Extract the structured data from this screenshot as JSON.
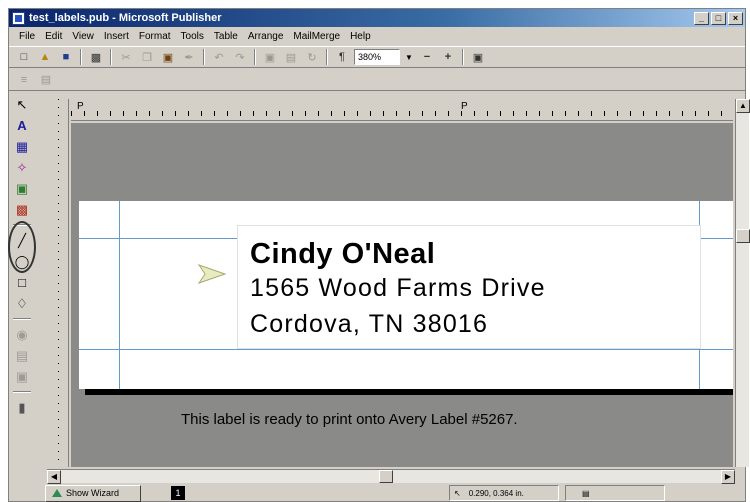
{
  "window": {
    "title": "test_labels.pub - Microsoft Publisher"
  },
  "menu": [
    "File",
    "Edit",
    "View",
    "Insert",
    "Format",
    "Tools",
    "Table",
    "Arrange",
    "MailMerge",
    "Help"
  ],
  "toolbar": {
    "zoom": "380%"
  },
  "ruler": {
    "first_indent": "P",
    "second_indent": "P"
  },
  "label": {
    "line1": "Cindy O'Neal",
    "line2": "1565 Wood Farms Drive",
    "line3": "Cordova, TN  38016"
  },
  "caption": "This label is ready to print onto Avery Label #5267.",
  "statusbar": {
    "wizard": "Show Wizard",
    "page": "1",
    "position": "0.290, 0.364 in."
  },
  "icons": [
    "new-icon",
    "open-icon",
    "save-icon",
    "print-icon",
    "cut-icon",
    "copy-icon",
    "paste-icon",
    "format-painter-icon",
    "undo-icon",
    "redo-icon",
    "bring-front-icon",
    "send-back-icon",
    "rotate-icon",
    "show-special-characters-icon",
    "zoom-out-icon",
    "zoom-in-icon",
    "help-icon",
    "pointer-icon",
    "text-frame-icon",
    "table-frame-icon",
    "wordart-icon",
    "picture-frame-icon",
    "clip-gallery-icon",
    "line-icon",
    "oval-icon",
    "rectangle-icon",
    "custom-shape-icon",
    "design-gallery-icon"
  ]
}
